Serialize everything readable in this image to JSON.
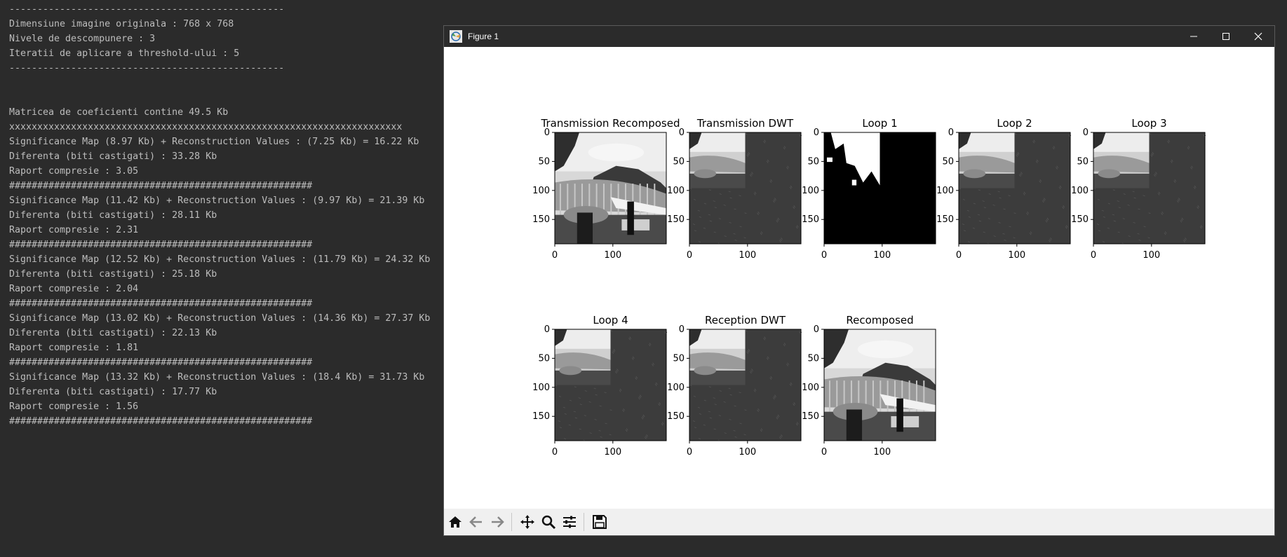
{
  "console": {
    "lines": [
      "-------------------------------------------------",
      "Dimensiune imagine originala : 768 x 768",
      "Nivele de descompunere : 3",
      "Iteratii de aplicare a threshold-ului : 5",
      "-------------------------------------------------",
      "",
      "",
      "Matricea de coeficienti contine 49.5 Kb",
      "xxxxxxxxxxxxxxxxxxxxxxxxxxxxxxxxxxxxxxxxxxxxxxxxxxxxxxxxxxxxxxxxxxxxxx",
      "Significance Map (8.97 Kb) + Reconstruction Values : (7.25 Kb) = 16.22 Kb",
      "Diferenta (biti castigati) : 33.28 Kb",
      "Raport compresie : 3.05",
      "######################################################",
      "Significance Map (11.42 Kb) + Reconstruction Values : (9.97 Kb) = 21.39 Kb",
      "Diferenta (biti castigati) : 28.11 Kb",
      "Raport compresie : 2.31",
      "######################################################",
      "Significance Map (12.52 Kb) + Reconstruction Values : (11.79 Kb) = 24.32 Kb",
      "Diferenta (biti castigati) : 25.18 Kb",
      "Raport compresie : 2.04",
      "######################################################",
      "Significance Map (13.02 Kb) + Reconstruction Values : (14.36 Kb) = 27.37 Kb",
      "Diferenta (biti castigati) : 22.13 Kb",
      "Raport compresie : 1.81",
      "######################################################",
      "Significance Map (13.32 Kb) + Reconstruction Values : (18.4 Kb) = 31.73 Kb",
      "Diferenta (biti castigati) : 17.77 Kb",
      "Raport compresie : 1.56",
      "######################################################"
    ]
  },
  "window": {
    "title": "Figure 1",
    "controls": [
      "minimize-icon",
      "maximize-icon",
      "close-icon"
    ]
  },
  "figure": {
    "subplots": [
      {
        "title": "Transmission Recomposed",
        "kind": "photo"
      },
      {
        "title": "Transmission DWT",
        "kind": "dwt"
      },
      {
        "title": "Loop 1",
        "kind": "binary"
      },
      {
        "title": "Loop 2",
        "kind": "dwt"
      },
      {
        "title": "Loop 3",
        "kind": "dwt"
      },
      {
        "title": "Loop 4",
        "kind": "dwt"
      },
      {
        "title": "Reception DWT",
        "kind": "dwt"
      },
      {
        "title": "Recomposed",
        "kind": "photo"
      }
    ],
    "yticks": [
      "0",
      "50",
      "100",
      "150"
    ],
    "xticks": [
      "0",
      "100"
    ]
  },
  "toolbar": {
    "buttons": [
      "home-icon",
      "back-arrow-icon",
      "forward-arrow-icon",
      "pan-icon",
      "zoom-icon",
      "configure-subplots-icon",
      "save-icon"
    ]
  },
  "colors": {
    "console_bg": "#2b2b2b",
    "console_text": "#bdbdbd",
    "dwt_bg": "#3c3c3c"
  }
}
